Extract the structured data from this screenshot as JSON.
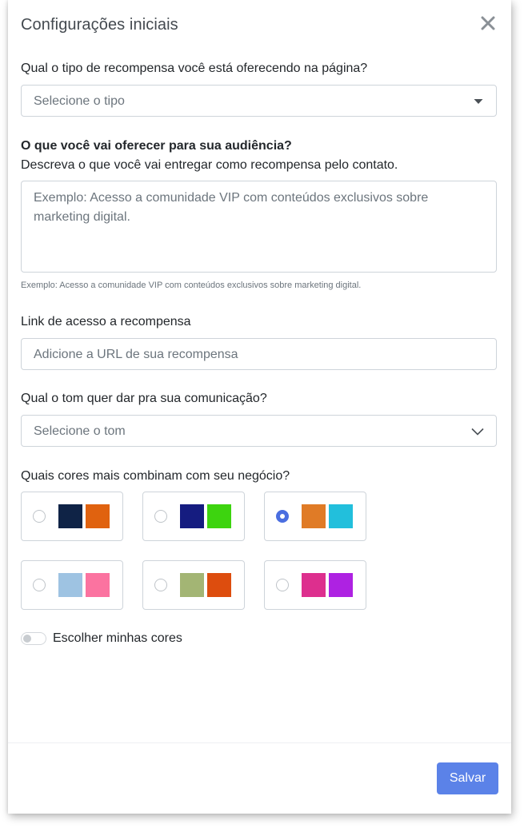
{
  "modal": {
    "title": "Configurações iniciais",
    "reward_type": {
      "label": "Qual o tipo de recompensa você está oferecendo na página?",
      "placeholder": "Selecione o tipo"
    },
    "offer": {
      "label": "O que você vai oferecer para sua audiência?",
      "description": "Descreva o que você vai entregar como recompensa pelo contato.",
      "placeholder": "Exemplo: Acesso a comunidade VIP com conteúdos exclusivos sobre marketing digital.",
      "hint": "Exemplo: Acesso a comunidade VIP com conteúdos exclusivos sobre marketing digital."
    },
    "link": {
      "label": "Link de acesso a recompensa",
      "placeholder": "Adicione a URL de sua recompensa"
    },
    "tone": {
      "label": "Qual o tom quer dar pra sua comunicação?",
      "placeholder": "Selecione o tom"
    },
    "colors": {
      "label": "Quais cores mais combinam com seu negócio?",
      "selected_index": 2,
      "palettes": [
        [
          "#0f2346",
          "#e0620f"
        ],
        [
          "#151c80",
          "#3dd40f"
        ],
        [
          "#e07b26",
          "#22bfdc"
        ],
        [
          "#9ec3e2",
          "#fb73a0"
        ],
        [
          "#a3b574",
          "#dd4d0e"
        ],
        [
          "#dd2f8e",
          "#ae22e2"
        ]
      ]
    },
    "custom_colors": {
      "label": "Escolher minhas cores",
      "enabled": false
    },
    "save_label": "Salvar"
  }
}
